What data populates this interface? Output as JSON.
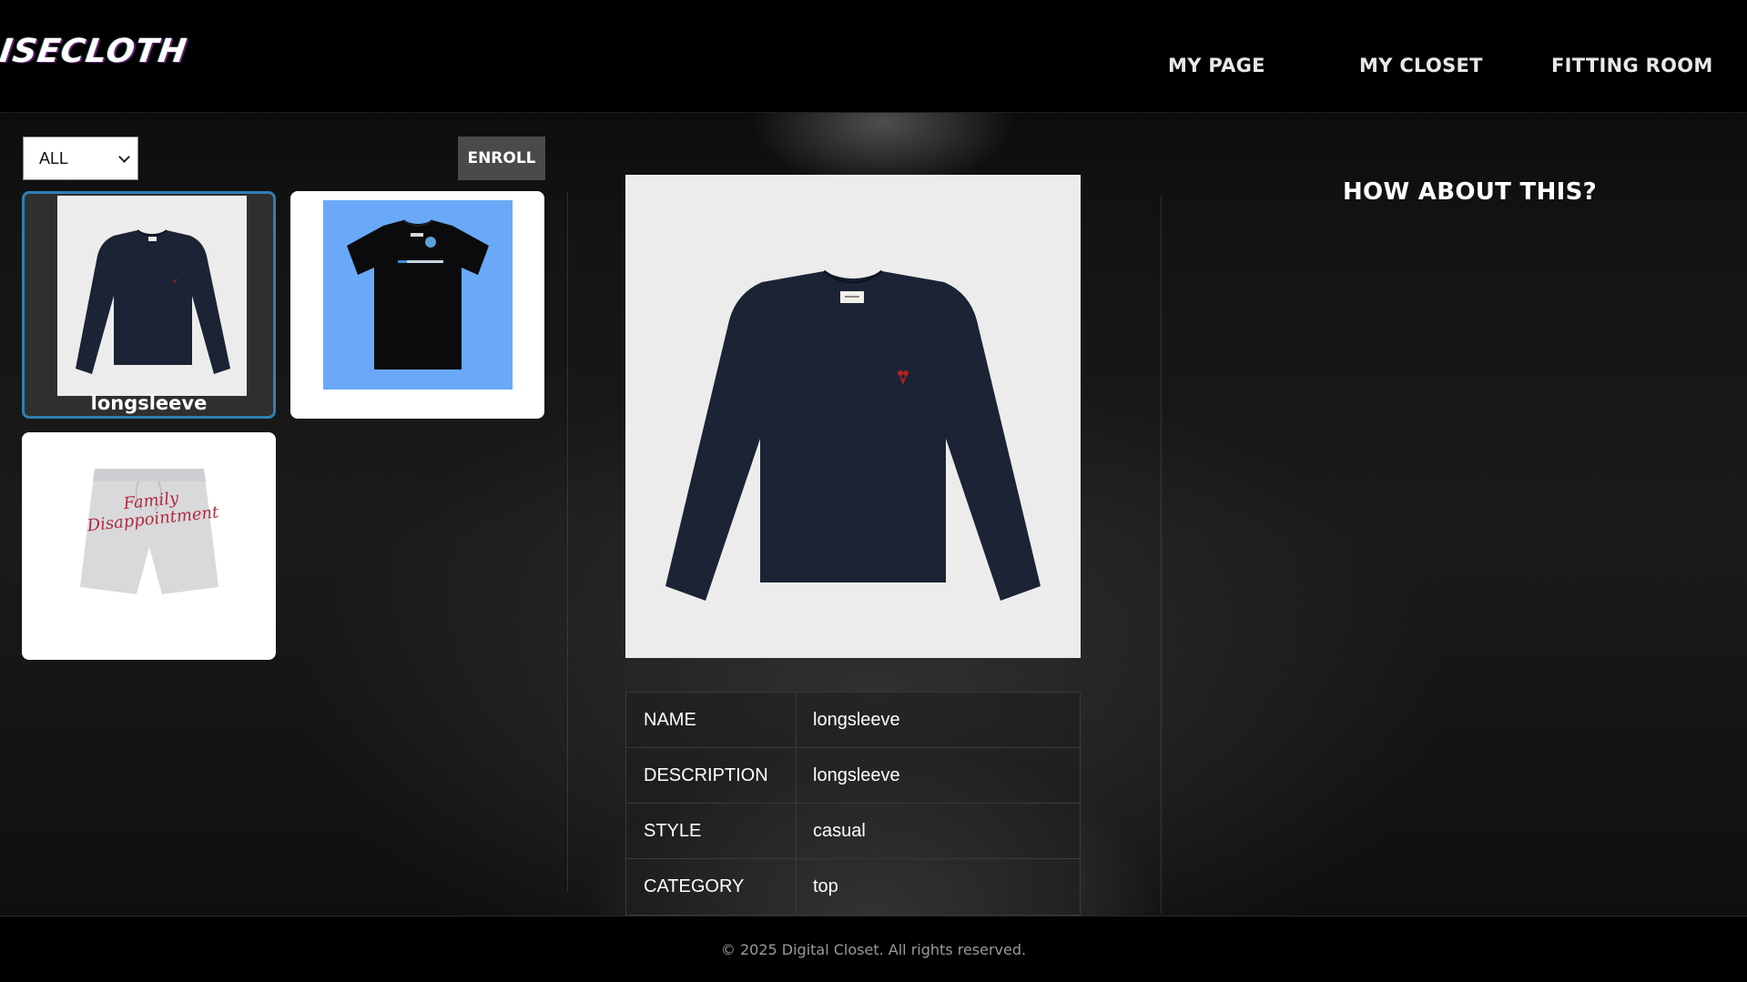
{
  "header": {
    "logo": "ISECLOTH",
    "nav": [
      "MY PAGE",
      "MY CLOSET",
      "FITTING ROOM"
    ]
  },
  "toolbar": {
    "filter_value": "ALL",
    "enroll_label": "ENROLL"
  },
  "closet": {
    "items": [
      {
        "caption": "longsleeve",
        "selected": true,
        "image": "navy-longsleeve-icon"
      },
      {
        "caption": "",
        "selected": false,
        "image": "black-tshirt-icon"
      },
      {
        "caption": "",
        "selected": false,
        "image": "grey-shorts-icon"
      }
    ],
    "shorts_print": [
      "Family",
      "Disappointment"
    ]
  },
  "detail": {
    "rows": [
      {
        "label": "NAME",
        "value": "longsleeve"
      },
      {
        "label": "DESCRIPTION",
        "value": "longsleeve"
      },
      {
        "label": "STYLE",
        "value": "casual"
      },
      {
        "label": "CATEGORY",
        "value": "top"
      }
    ]
  },
  "suggest": {
    "title": "HOW ABOUT THIS?"
  },
  "footer": {
    "text": "© 2025 Digital Closet. All rights reserved."
  },
  "colors": {
    "selected_border": "#2e7fb5",
    "tshirt_bg": "#6aa9f7",
    "garment_navy": "#1b2335"
  }
}
